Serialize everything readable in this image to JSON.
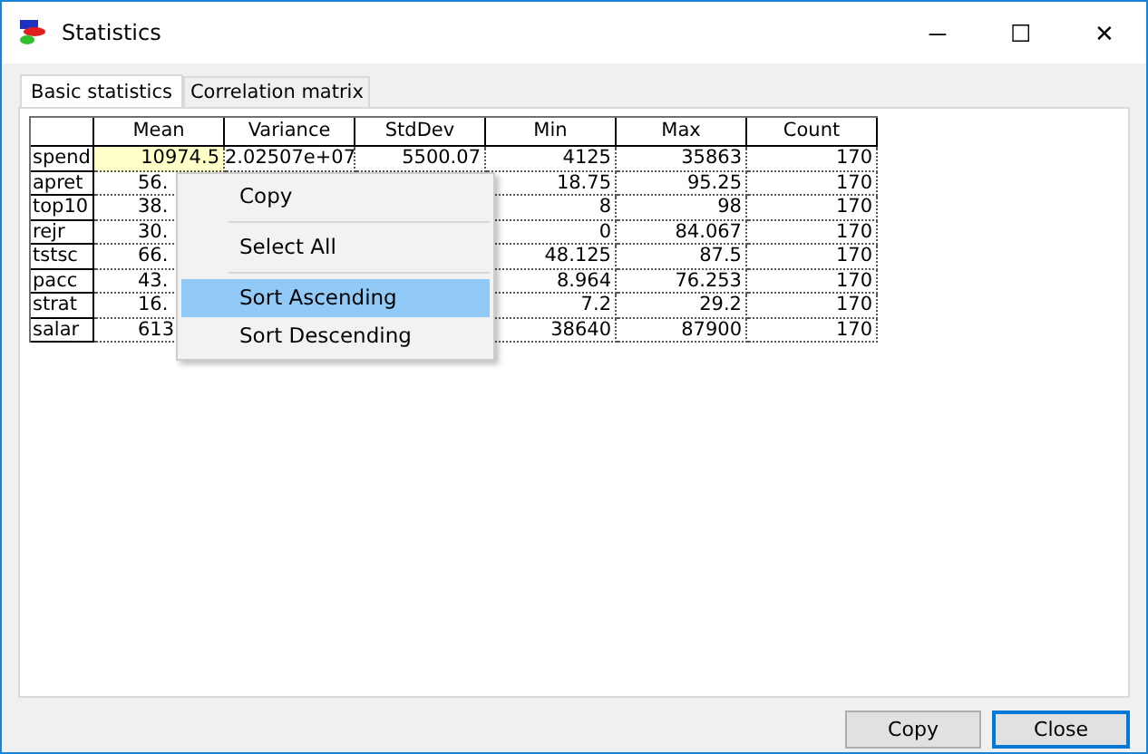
{
  "window": {
    "title": "Statistics",
    "controls": [
      "─",
      "☐",
      "✕"
    ]
  },
  "tabs": [
    {
      "label": "Basic statistics",
      "selected": true
    },
    {
      "label": "Correlation matrix",
      "selected": false
    }
  ],
  "table": {
    "columns": [
      "Mean",
      "Variance",
      "StdDev",
      "Min",
      "Max",
      "Count"
    ],
    "rows": [
      {
        "name": "spend",
        "cells": [
          "10974.5",
          "2.02507e+07",
          "5500.07",
          "4125",
          "35863",
          "170"
        ],
        "selected": [
          true,
          false,
          false,
          false,
          false,
          false
        ]
      },
      {
        "name": "apret",
        "cells": [
          "56.",
          null,
          null,
          "18.75",
          "95.25",
          "170"
        ]
      },
      {
        "name": "top10",
        "cells": [
          "38.",
          null,
          null,
          "8",
          "98",
          "170"
        ]
      },
      {
        "name": "rejr",
        "cells": [
          "30.",
          null,
          null,
          "0",
          "84.067",
          "170"
        ]
      },
      {
        "name": "tstsc",
        "cells": [
          "66.",
          null,
          null,
          "48.125",
          "87.5",
          "170"
        ]
      },
      {
        "name": "pacc",
        "cells": [
          "43.",
          null,
          null,
          "8.964",
          "76.253",
          "170"
        ]
      },
      {
        "name": "strat",
        "cells": [
          "16.",
          null,
          null,
          "7.2",
          "29.2",
          "170"
        ]
      },
      {
        "name": "salar",
        "cells": [
          "613",
          null,
          null,
          "38640",
          "87900",
          "170"
        ]
      }
    ]
  },
  "context_menu": [
    {
      "kind": "item",
      "label": "Copy",
      "selected": false
    },
    {
      "kind": "separator"
    },
    {
      "kind": "item",
      "label": "Select All",
      "selected": false
    },
    {
      "kind": "separator"
    },
    {
      "kind": "item",
      "label": "Sort Ascending",
      "selected": true
    },
    {
      "kind": "item",
      "label": "Sort Descending",
      "selected": false
    }
  ],
  "buttons": [
    {
      "label": "Copy",
      "default": false
    },
    {
      "label": "Close",
      "default": true
    }
  ]
}
